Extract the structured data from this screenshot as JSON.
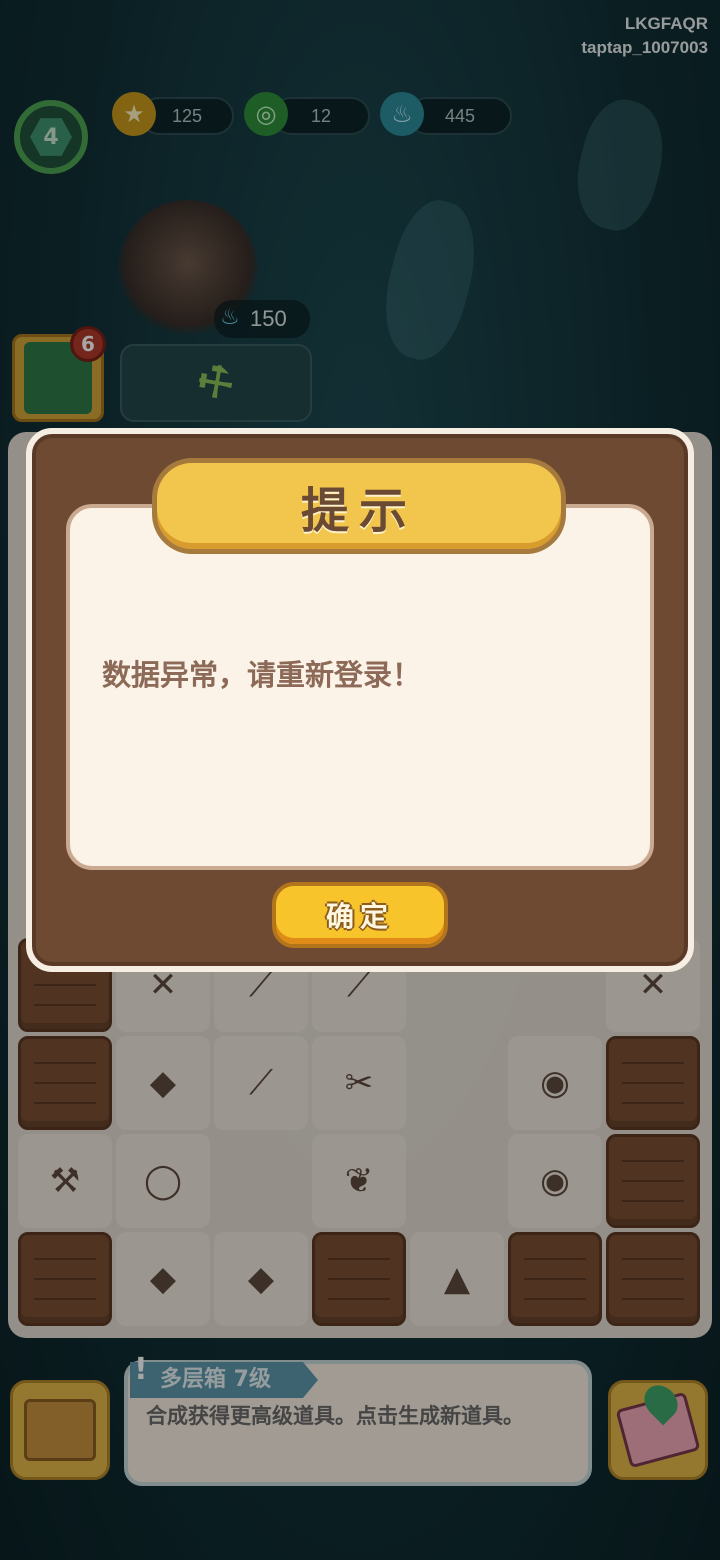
{
  "user": {
    "line1": "LKGFAQR",
    "line2": "taptap_1007003"
  },
  "hud": {
    "level": "4",
    "coins": "125",
    "gems": "12",
    "flames": "445",
    "energy": "150",
    "quest_count": "6"
  },
  "dialog": {
    "title": "提示",
    "message": "数据异常，请重新登录！",
    "confirm_label": "确定"
  },
  "info": {
    "name": "多层箱 7级",
    "description": "合成获得更高级道具。点击生成新道具。"
  },
  "icons": {
    "coin": "coin-icon",
    "gem": "gem-icon",
    "flame": "flame-icon",
    "hammer": "hammer-icon",
    "box": "box-icon",
    "map": "map-icon"
  },
  "colors": {
    "dialog_frame": "#6f4a33",
    "banner": "#f2c54c",
    "confirm_button": "#f7c42c",
    "message_text": "#8c6a57"
  }
}
